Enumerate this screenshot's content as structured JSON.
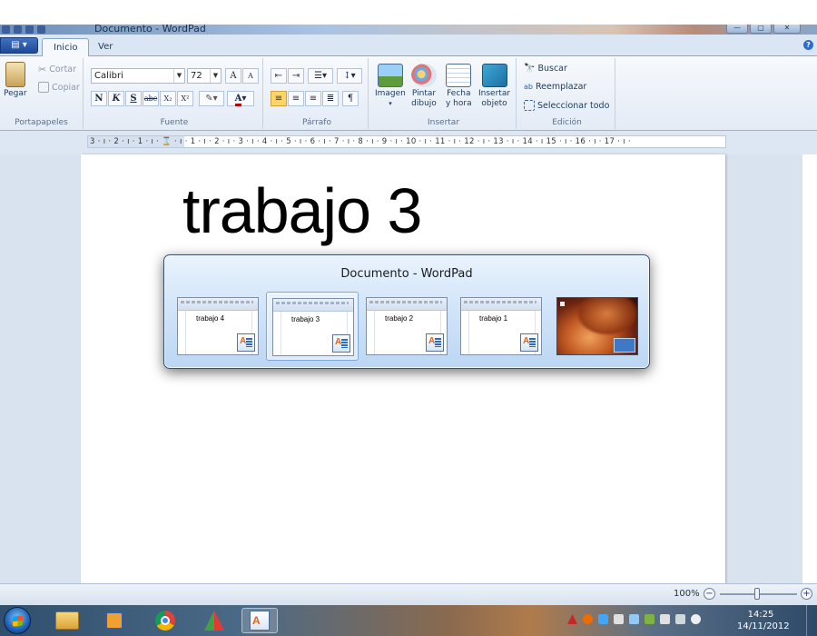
{
  "window": {
    "title": "Documento - WordPad",
    "controls": [
      "minimize",
      "maximize",
      "close"
    ]
  },
  "ribbon": {
    "tabs": [
      {
        "label": "Inicio",
        "active": true
      },
      {
        "label": "Ver",
        "active": false
      }
    ],
    "groups": {
      "portapapeles": {
        "label": "Portapapeles",
        "paste": "Pegar",
        "cut": "Cortar",
        "copy": "Copiar"
      },
      "fuente": {
        "label": "Fuente",
        "font_name": "Calibri",
        "font_size": "72",
        "bold": "N",
        "italic": "K",
        "underline": "S",
        "strike": "abc",
        "subscript": "X₂",
        "superscript": "X²",
        "grow": "A",
        "shrink": "A"
      },
      "parrafo": {
        "label": "Párrafo"
      },
      "insertar": {
        "label": "Insertar",
        "image": "Imagen",
        "paint_1": "Pintar",
        "paint_2": "dibujo",
        "datetime_1": "Fecha",
        "datetime_2": "y hora",
        "object_1": "Insertar",
        "object_2": "objeto"
      },
      "edicion": {
        "label": "Edición",
        "find": "Buscar",
        "replace": "Reemplazar",
        "select_all": "Seleccionar todo"
      }
    }
  },
  "ruler": {
    "text": "3 · ı · 2 · ı · 1 · ı · ⌛ · ı · 1 · ı · 2 · ı · 3 · ı · 4 · ı · 5 · ı · 6 · ı · 7 · ı · 8 · ı · 9 · ı · 10 · ı · 11 · ı · 12 · ı · 13 · ı · 14 · ı 15 · ı · 16 · ı · 17 · ı ·"
  },
  "document": {
    "text": "trabajo 3"
  },
  "switcher": {
    "title": "Documento - WordPad",
    "windows": [
      {
        "label": "trabajo 4",
        "selected": false
      },
      {
        "label": "trabajo 3",
        "selected": true
      },
      {
        "label": "trabajo 2",
        "selected": false
      },
      {
        "label": "trabajo 1",
        "selected": false
      },
      {
        "label": "",
        "desktop": true
      }
    ]
  },
  "statusbar": {
    "zoom": "100%",
    "zoom_minus": "−",
    "zoom_plus": "+"
  },
  "taskbar": {
    "pinned": [
      "explorer-icon",
      "media-player-icon",
      "chrome-icon",
      "app-icon",
      "wordpad-icon"
    ],
    "time": "14:25",
    "date": "14/11/2012"
  }
}
